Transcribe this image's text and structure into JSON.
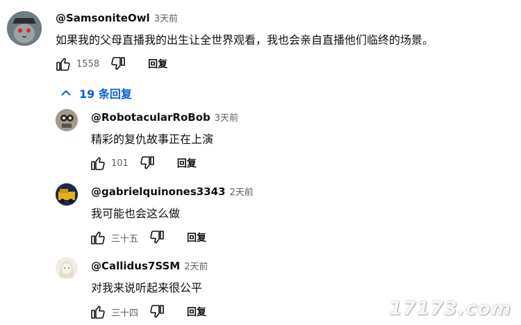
{
  "comments": [
    {
      "author": "@SamsoniteOwl",
      "time": "3天前",
      "text": "如果我的父母直播我的出生让全世界观看，我也会亲自直播他们临终的场景。",
      "likes": "1558",
      "reply_label": "回复"
    }
  ],
  "replies_toggle": {
    "label": "19 条回复",
    "icon": "chevron-up-icon"
  },
  "replies": [
    {
      "author": "@RobotacularRoBob",
      "time": "3天前",
      "text": "精彩的复仇故事正在上演",
      "likes": "101",
      "reply_label": "回复"
    },
    {
      "author": "@gabrielquinones3343",
      "time": "2天前",
      "text": "我可能也会这么做",
      "likes": "三十五",
      "reply_label": "回复"
    },
    {
      "author": "@Callidus7SSM",
      "time": "2天前",
      "text": "对我来说听起来很公平",
      "likes": "三十四",
      "reply_label": "回复"
    }
  ],
  "watermark": "17173.com",
  "colors": {
    "link": "#065fd4",
    "secondary_text": "#606060",
    "primary_text": "#0f0f0f"
  }
}
